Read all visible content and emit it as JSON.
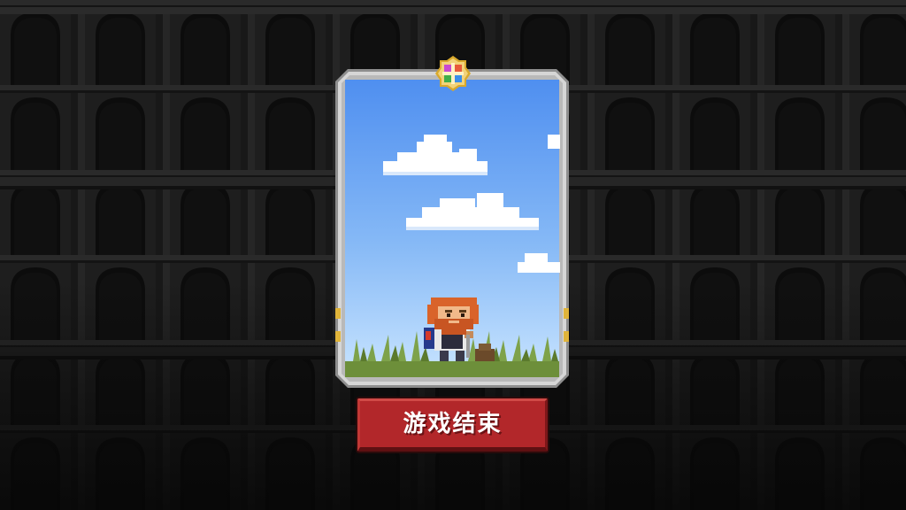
{
  "screen": {
    "name": "game-over"
  },
  "card": {
    "emblem_icon": "four-color-cross-emblem-icon",
    "scene": "sky-clouds-grass",
    "character": "red-bearded-hero"
  },
  "game_over_button": {
    "label": "游戏结束"
  },
  "colors": {
    "background_wall": "#1c1c1c",
    "arch_dark": "#0b0b0b",
    "card_frame": "#c9c9c9",
    "sky_top": "#4f8ff0",
    "sky_bottom": "#bfe0ff",
    "button_red": "#b2272a"
  }
}
